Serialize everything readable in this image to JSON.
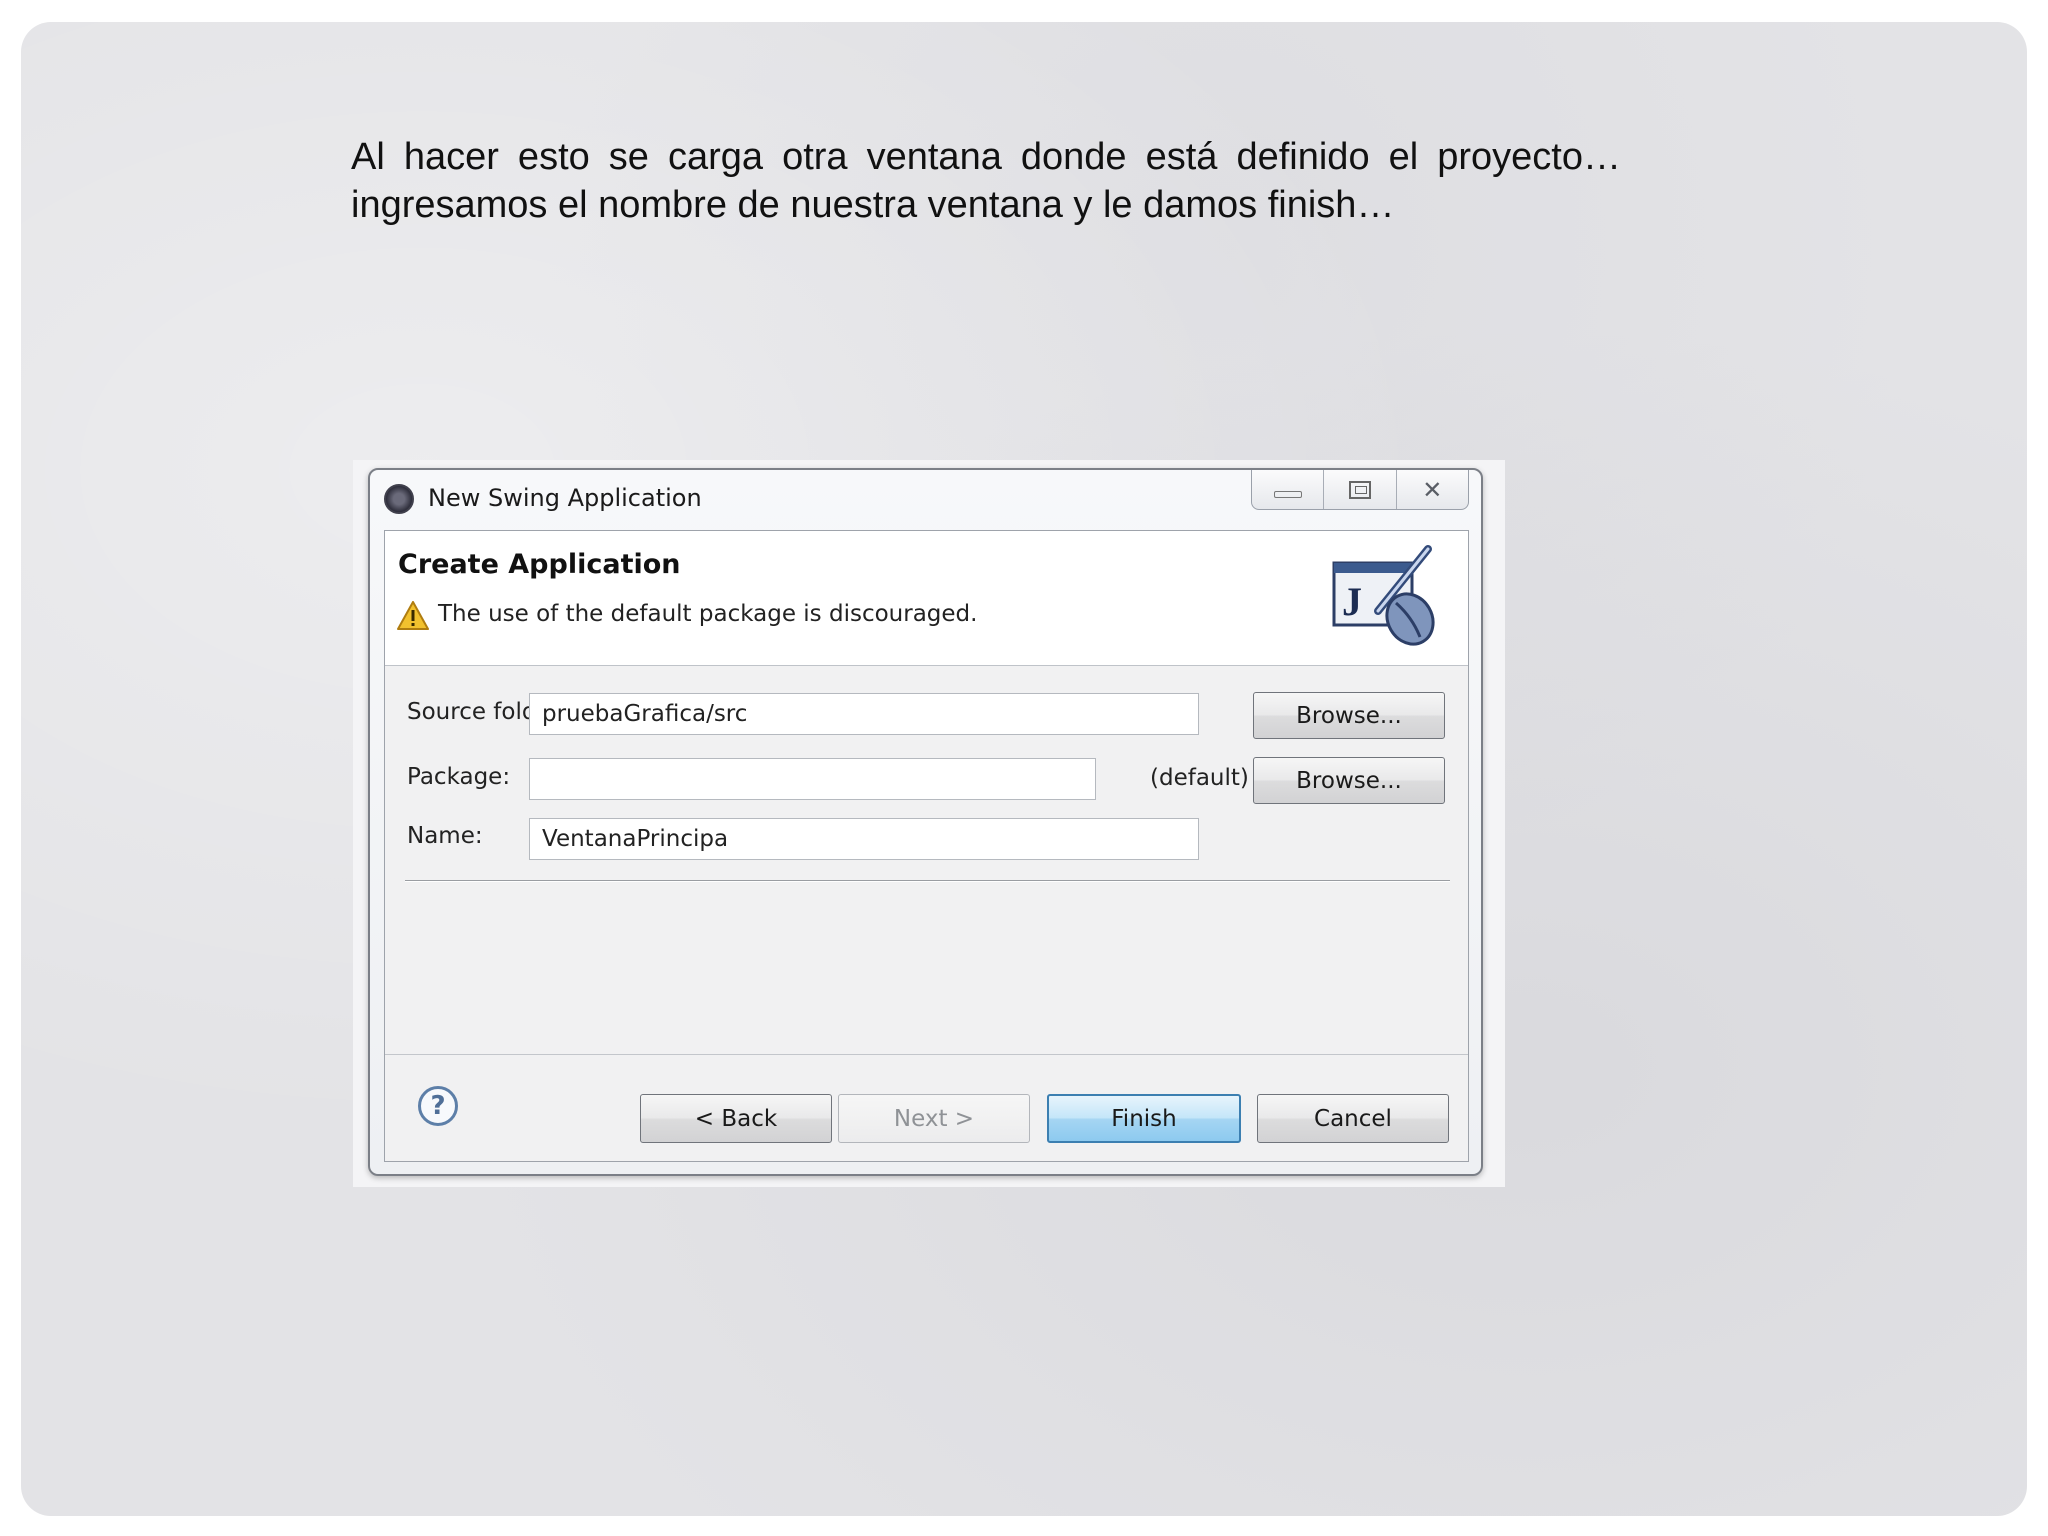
{
  "caption": {
    "line1": "Al hacer esto se carga otra ventana donde está definido el proyecto…",
    "line2": "ingresamos el nombre de nuestra ventana y le damos finish…"
  },
  "dialog": {
    "title": "New Swing Application",
    "banner_title": "Create Application",
    "warning": "The use of the default package is discouraged.",
    "fields": {
      "source_folder": {
        "label": "Source folder:",
        "value": "pruebaGrafica/src"
      },
      "package": {
        "label": "Package:",
        "value": "",
        "suffix": "(default)"
      },
      "name": {
        "label": "Name:",
        "value": "VentanaPrincipa"
      }
    },
    "browse_label": "Browse...",
    "buttons": {
      "back": "< Back",
      "next": "Next >",
      "finish": "Finish",
      "cancel": "Cancel"
    },
    "icons": {
      "app": "eclipse-icon",
      "warning": "warning-icon",
      "banner": "java-pen-icon",
      "help": "help-icon"
    },
    "colors": {
      "accent": "#3c7fb1",
      "warning": "#f2c12e"
    }
  }
}
